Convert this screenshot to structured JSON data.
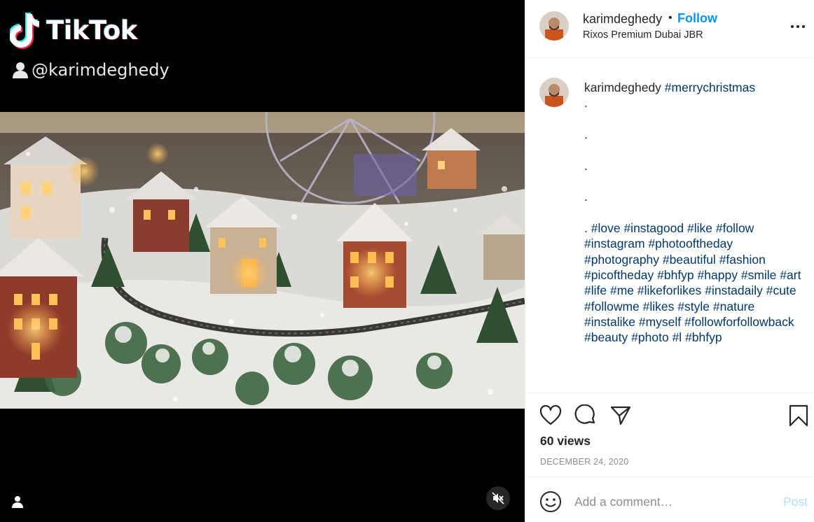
{
  "video": {
    "brand": "TikTok",
    "handle": "@karimdeghedy"
  },
  "header": {
    "username": "karimdeghedy",
    "separator": "•",
    "follow_label": "Follow",
    "location": "Rixos Premium Dubai JBR"
  },
  "caption": {
    "username": "karimdeghedy",
    "first_tag": "#merrychristmas",
    "dots": [
      ".",
      ".",
      ".",
      "."
    ],
    "lead": ". ",
    "tags": [
      "#love",
      "#instagood",
      "#like",
      "#follow",
      "#instagram",
      "#photooftheday",
      "#photography",
      "#beautiful",
      "#fashion",
      "#picoftheday",
      "#bhfyp",
      "#happy",
      "#smile",
      "#art",
      "#life",
      "#me",
      "#likeforlikes",
      "#instadaily",
      "#cute",
      "#followme",
      "#likes",
      "#style",
      "#nature",
      "#instalike",
      "#myself",
      "#followforfollowback",
      "#beauty",
      "#photo",
      "#l",
      "#bhfyp"
    ]
  },
  "stats": {
    "views": "60 views",
    "date": "DECEMBER 24, 2020"
  },
  "comment": {
    "placeholder": "Add a comment…",
    "post_label": "Post"
  },
  "colors": {
    "accent": "#0095f6",
    "tag": "#00376b",
    "post_disabled": "#b2dffc",
    "muted": "#8e8e8e"
  },
  "icons": [
    "tiktok-logo-icon",
    "user-icon",
    "mute-icon",
    "more-options-icon",
    "heart-icon",
    "comment-icon",
    "share-icon",
    "bookmark-icon",
    "emoji-icon"
  ]
}
